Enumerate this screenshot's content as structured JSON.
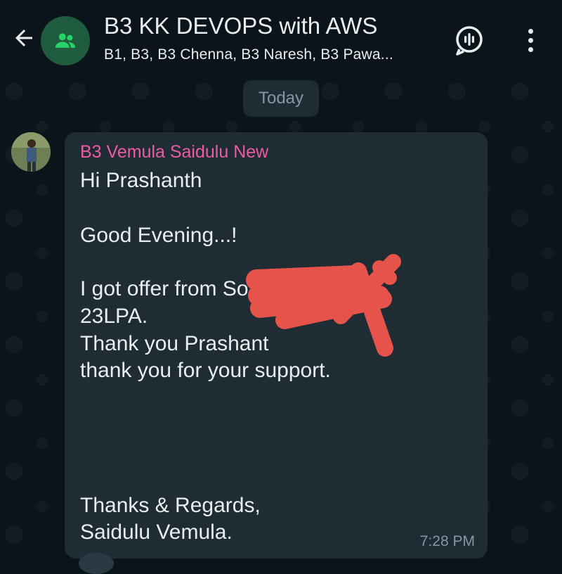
{
  "header": {
    "title": "B3 KK DEVOPS with AWS",
    "subtitle": "B1, B3, B3 Chenna, B3 Naresh, B3 Pawa..."
  },
  "date_chip": "Today",
  "message": {
    "sender": "B3 Vemula Saidulu New",
    "lines": [
      "Hi Prashanth",
      "Good Evening...!",
      "I got offer from So                    e for",
      "23LPA.",
      "Thank you Prashant",
      "thank you for your support.",
      "Thanks & Regards,",
      "Saidulu Vemula."
    ],
    "time": "7:28 PM"
  },
  "colors": {
    "background": "#0b141a",
    "bubble": "#202c33",
    "sender_name": "#ec5c9f",
    "accent_green": "#1f5c3e",
    "redaction": "#e5534b"
  },
  "icons": {
    "back": "arrow-left-icon",
    "group_avatar": "group-icon",
    "voice_chat": "voice-chat-icon",
    "menu": "more-vertical-icon"
  }
}
